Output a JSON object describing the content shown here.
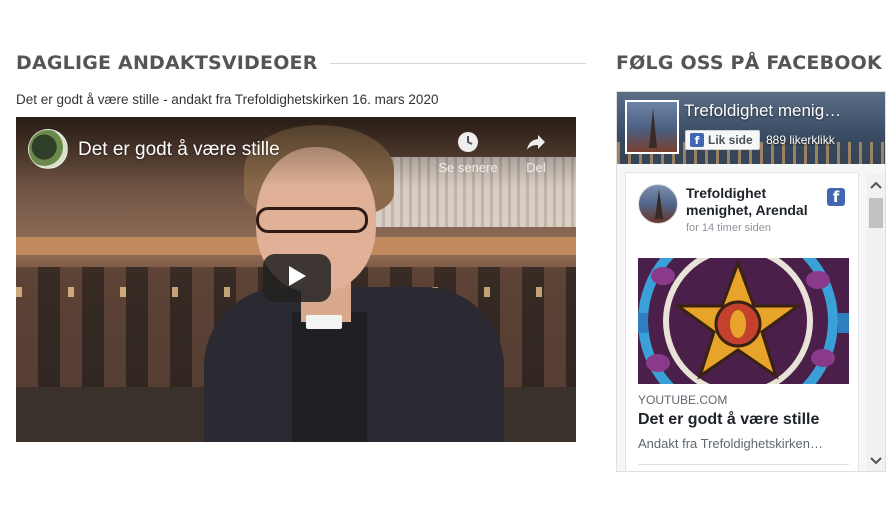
{
  "left_section": {
    "heading": "DAGLIGE ANDAKTSVIDEOER",
    "caption": "Det er godt å være stille - andakt fra Trefoldighetskirken 16. mars 2020"
  },
  "video": {
    "title": "Det er godt å være stille",
    "watch_later_label": "Se senere",
    "share_label": "Del",
    "icons": [
      "clock-icon",
      "share-arrow-icon",
      "play-icon"
    ]
  },
  "right_section": {
    "heading": "FØLG OSS PÅ FACEBOOK"
  },
  "facebook": {
    "page_name": "Trefoldighet menighet, Arendal",
    "page_name_cover": "Trefoldighet menig…",
    "like_button_label": "Lik side",
    "like_count": "889 likerklikk",
    "post": {
      "author": "Trefoldighet menighet, Arendal",
      "time": "for 14 timer siden",
      "link_domain": "YOUTUBE.COM",
      "link_title": "Det er godt å være stille",
      "link_description": "Andakt fra Trefoldighetskirken…"
    },
    "colors": {
      "brand": "#4267b2"
    }
  }
}
